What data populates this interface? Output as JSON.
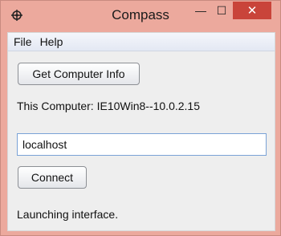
{
  "window": {
    "title": "Compass"
  },
  "titlebar_controls": {
    "minimize": "—",
    "maximize": "☐",
    "close": "✕"
  },
  "menu": [
    {
      "label": "File"
    },
    {
      "label": "Help"
    }
  ],
  "main": {
    "get_info_button": "Get Computer Info",
    "computer_label": "This Computer: IE10Win8--10.0.2.15",
    "host_input_value": "localhost",
    "connect_button": "Connect",
    "status_text": "Launching interface."
  },
  "colors": {
    "titlebar": "#eca99d",
    "close_button": "#c9443a",
    "client": "#eeeeee",
    "input_border": "#7aa2d6"
  },
  "icons": {
    "app": "compass-icon"
  }
}
